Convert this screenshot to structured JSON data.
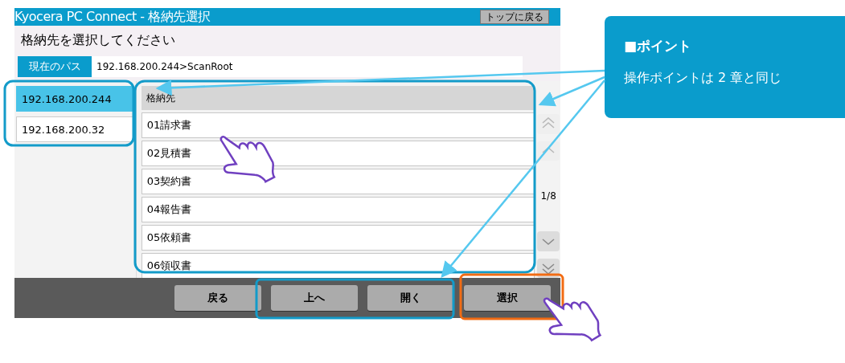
{
  "window": {
    "title": "Kyocera PC Connect - 格納先選択",
    "top_button": "トップに戻る"
  },
  "prompt": "格納先を選択してください",
  "path": {
    "label": "現在のパス",
    "value": "192.168.200.244>ScanRoot"
  },
  "servers": [
    {
      "label": "192.168.200.244",
      "selected": true
    },
    {
      "label": "192.168.200.32",
      "selected": false
    }
  ],
  "folders": {
    "header": "格納先",
    "items": [
      "01請求書",
      "02見積書",
      "03契約書",
      "04報告書",
      "05依頼書",
      "06領収書"
    ]
  },
  "pager": {
    "page": "1/8",
    "buttons": [
      {
        "kind": "first",
        "disabled": true
      },
      {
        "kind": "prev",
        "disabled": true
      },
      {
        "kind": "next",
        "disabled": false
      },
      {
        "kind": "last",
        "disabled": false
      }
    ]
  },
  "buttons": [
    "戻る",
    "上へ",
    "開く",
    "選択"
  ],
  "callout": {
    "title": "■ポイント",
    "text": "操作ポイントは 2 章と同じ"
  }
}
